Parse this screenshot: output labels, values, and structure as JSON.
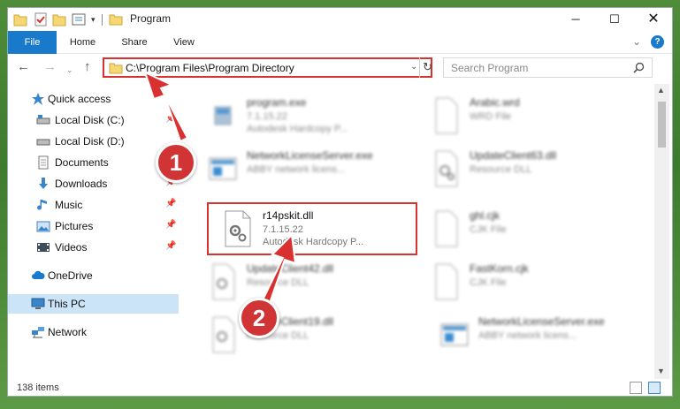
{
  "window": {
    "title": "Program"
  },
  "title_bar": {
    "minimize_icon": "minimize-icon",
    "maximize_icon": "maximize-icon",
    "close_icon": "close-icon"
  },
  "ribbon": {
    "tabs": [
      "File",
      "Home",
      "Share",
      "View"
    ]
  },
  "address_bar": {
    "path": "C:\\Program Files\\Program Directory"
  },
  "search": {
    "placeholder": "Search Program"
  },
  "sidebar": {
    "items": [
      {
        "label": "Quick access",
        "icon": "star-icon"
      },
      {
        "label": "Local Disk (C:)",
        "icon": "drive-icon",
        "pinned": true
      },
      {
        "label": "Local Disk (D:)",
        "icon": "drive-icon"
      },
      {
        "label": "Documents",
        "icon": "documents-icon",
        "pinned": true
      },
      {
        "label": "Downloads",
        "icon": "download-icon",
        "pinned": true
      },
      {
        "label": "Music",
        "icon": "music-icon",
        "pinned": true
      },
      {
        "label": "Pictures",
        "icon": "pictures-icon",
        "pinned": true
      },
      {
        "label": "Videos",
        "icon": "videos-icon",
        "pinned": true
      },
      {
        "label": "OneDrive",
        "icon": "cloud-icon"
      },
      {
        "label": "This PC",
        "icon": "computer-icon",
        "selected": true
      },
      {
        "label": "Network",
        "icon": "network-icon"
      }
    ]
  },
  "files": [
    {
      "name": "program.exe",
      "line1": "7.1.15.22",
      "line2": "Autodesk Hardcopy P...",
      "type": "exe"
    },
    {
      "name": "Arabic.wrd",
      "line1": "WRD File",
      "line2": "",
      "type": "doc"
    },
    {
      "name": "NetworkLicenseServer.exe",
      "line1": "ABBY network licens...",
      "line2": "",
      "type": "app"
    },
    {
      "name": "UpdateClient63.dll",
      "line1": "Resource DLL",
      "line2": "",
      "type": "dll"
    },
    {
      "name": "r14pskit.dll",
      "line1": "7.1.15.22",
      "line2": "Autodesk Hardcopy P...",
      "type": "dll",
      "highlighted": true
    },
    {
      "name": "ghl.cjk",
      "line1": "CJK File",
      "line2": "",
      "type": "doc"
    },
    {
      "name": "UpdateClient42.dll",
      "line1": "Resource DLL",
      "line2": "",
      "type": "dll"
    },
    {
      "name": "FastKorn.cjk",
      "line1": "CJK File",
      "line2": "",
      "type": "doc"
    },
    {
      "name": "UpdateClient19.dll",
      "line1": "Resource DLL",
      "line2": "",
      "type": "dll"
    },
    {
      "name": "NetworkLicenseServer.exe",
      "line1": "ABBY network licens...",
      "line2": "",
      "type": "app"
    }
  ],
  "annotations": {
    "step1": "1",
    "step2": "2",
    "accent": "#d9312f"
  },
  "status_bar": {
    "item_count": "138 items"
  }
}
